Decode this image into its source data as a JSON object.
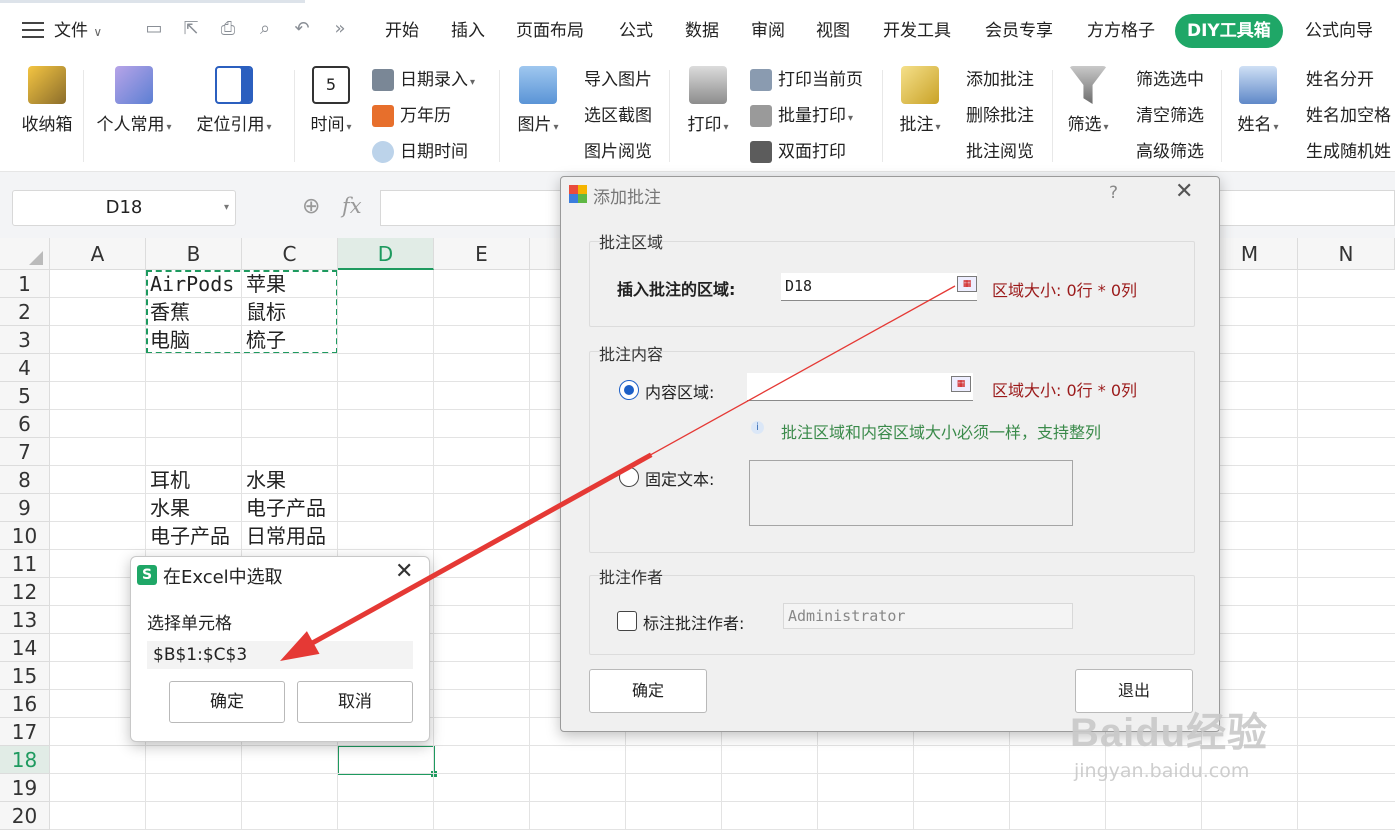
{
  "menu": {
    "file": "文件",
    "tabs": [
      "开始",
      "插入",
      "页面布局",
      "公式",
      "数据",
      "审阅",
      "视图",
      "开发工具",
      "会员专享",
      "方方格子",
      "DIY工具箱",
      "公式向导"
    ],
    "active_tab": "DIY工具箱"
  },
  "ribbon": {
    "receive_box": "收纳箱",
    "personal_common": "个人常用",
    "locate_ref": "定位引用",
    "time": "时间",
    "date_entry": "日期录入",
    "perpetual_calendar": "万年历",
    "date_time": "日期时间",
    "image": "图片",
    "import_image": "导入图片",
    "select_capture": "选区截图",
    "image_browse": "图片阅览",
    "print": "打印",
    "print_current_page": "打印当前页",
    "batch_print": "批量打印",
    "duplex_print": "双面打印",
    "comment": "批注",
    "add_comment": "添加批注",
    "delete_comment": "删除批注",
    "comment_browse": "批注阅览",
    "filter": "筛选",
    "filter_selected": "筛选选中",
    "clear_filter": "清空筛选",
    "advanced_filter": "高级筛选",
    "name": "姓名",
    "name_split": "姓名分开",
    "name_add_space": "姓名加空格",
    "random_name": "生成随机姓"
  },
  "formula_bar": {
    "name_box": "D18",
    "fx": "fx"
  },
  "sheet": {
    "columns": [
      "A",
      "B",
      "C",
      "D",
      "E",
      "M",
      "N"
    ],
    "rows": [
      "1",
      "2",
      "3",
      "4",
      "5",
      "6",
      "7",
      "8",
      "9",
      "10",
      "11",
      "12",
      "13",
      "14",
      "15",
      "16",
      "17",
      "18",
      "19",
      "20"
    ],
    "cells": {
      "B1": "AirPods",
      "C1": "苹果",
      "B2": "香蕉",
      "C2": "鼠标",
      "B3": "电脑",
      "C3": "梳子",
      "B8": "耳机",
      "C8": "水果",
      "B9": "水果",
      "C9": "电子产品",
      "B10": "电子产品",
      "C10": "日常用品"
    }
  },
  "dialog_add_comment": {
    "title": "添加批注",
    "help": "?",
    "group_area": "批注区域",
    "insert_area_label": "插入批注的区域:",
    "insert_area_value": "D18",
    "area_size_1": "区域大小: 0行 * 0列",
    "group_content": "批注内容",
    "content_area_label": "内容区域:",
    "content_area_value": "",
    "area_size_2": "区域大小: 0行 * 0列",
    "hint": "批注区域和内容区域大小必须一样，支持整列",
    "fixed_text_label": "固定文本:",
    "group_author": "批注作者",
    "author_label": "标注批注作者:",
    "author_value": "Administrator",
    "ok": "确定",
    "exit": "退出"
  },
  "dialog_pick": {
    "title": "在Excel中选取",
    "prompt": "选择单元格",
    "value": "$B$1:$C$3",
    "ok": "确定",
    "cancel": "取消"
  },
  "watermark": {
    "logo": "Baidu经验",
    "url": "jingyan.baidu.com"
  },
  "colors": {
    "accent": "#1fa767",
    "arrow": "#e53935",
    "selection": "#1e9a5f"
  }
}
